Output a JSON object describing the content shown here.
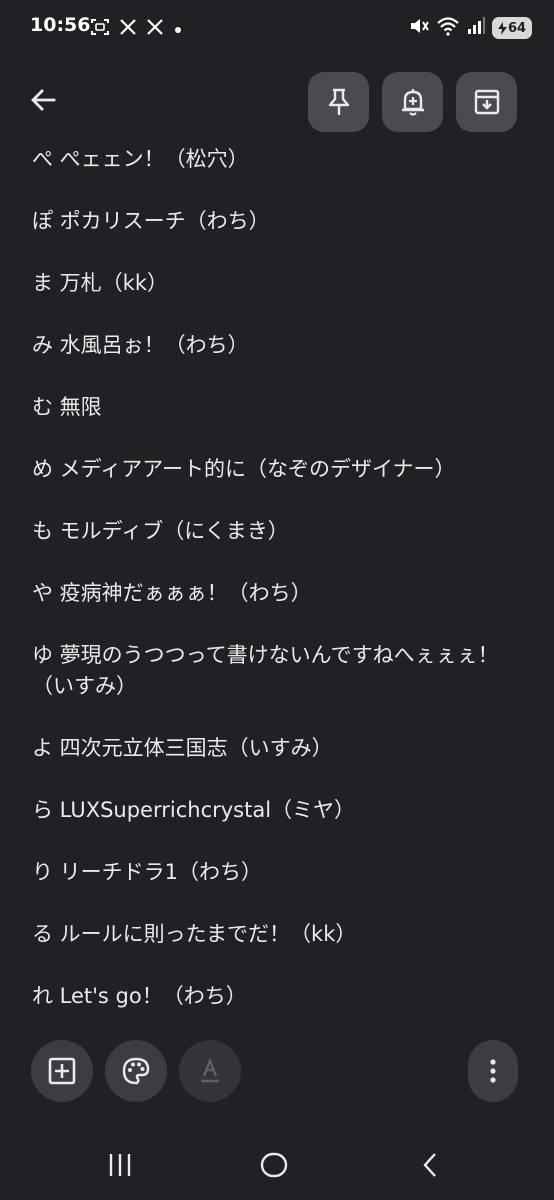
{
  "status_bar": {
    "time": "10:56",
    "left_icons": [
      "screenshot-icon",
      "x-app-icon",
      "x-app-icon",
      "notification-dot-icon"
    ],
    "right_icons": [
      "mute-vibrate-icon",
      "wifi-icon",
      "signal-icon"
    ],
    "battery_level": "64",
    "battery_charging": true
  },
  "toolbar": {
    "back_icon": "arrow-back-icon",
    "pin_icon": "pin-icon",
    "reminder_icon": "add-reminder-bell-icon",
    "archive_icon": "archive-icon"
  },
  "note": {
    "lines": [
      "ぺ ぺェェン！（松穴）",
      "ぽ ポカリスーチ（わち）",
      "ま 万札（kk）",
      "み 水風呂ぉ！（わち）",
      "む 無限",
      "め メディアアート的に（なぞのデザイナー）",
      "も モルディブ（にくまき）",
      "や 疫病神だぁぁぁ！（わち）",
      "ゆ  夢現のうつつって書けないんですねへぇぇぇ！（いすみ）",
      "よ 四次元立体三国志（いすみ）",
      "ら LUXSuperrichcrystal（ミヤ）",
      "り リーチドラ1（わち）",
      "る ルールに則ったまでだ！（kk）",
      "れ Let's go！（わち）"
    ]
  },
  "bottom_bar": {
    "add_icon": "add-box-icon",
    "palette_icon": "palette-icon",
    "text_format_icon": "text-format-icon",
    "more_icon": "more-vert-icon"
  },
  "nav_bar": {
    "recents_icon": "recents-icon",
    "home_icon": "home-icon",
    "back_icon": "back-chevron-icon"
  },
  "colors": {
    "background": "#202124",
    "text": "#e8eaed",
    "button_bg": "#4a4b4e"
  }
}
